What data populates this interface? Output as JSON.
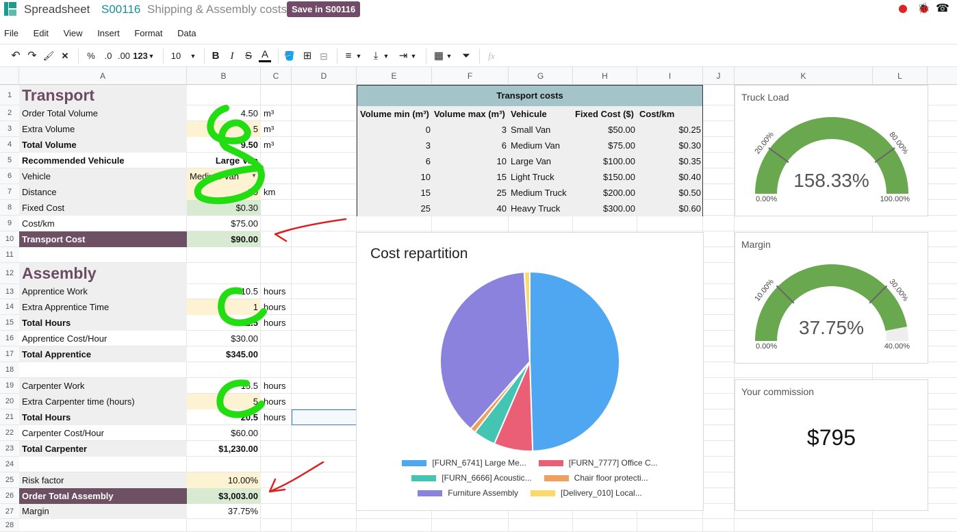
{
  "app": {
    "name": "Spreadsheet",
    "record": "S00116",
    "doc_title": "Shipping & Assembly costs",
    "save_button": "Save in S00116"
  },
  "menu": [
    "File",
    "Edit",
    "View",
    "Insert",
    "Format",
    "Data"
  ],
  "toolbar": {
    "percent": "%",
    "dec_less": ".0",
    "dec_more": ".00",
    "format": "123",
    "font_size": "10",
    "bold": "B",
    "italic": "I",
    "strike": "S",
    "text_color": "A",
    "fx": "fx"
  },
  "columns": [
    "A",
    "B",
    "C",
    "D",
    "E",
    "F",
    "G",
    "H",
    "I",
    "J",
    "K",
    "L"
  ],
  "rows": [
    "1",
    "2",
    "3",
    "4",
    "5",
    "6",
    "7",
    "8",
    "9",
    "10",
    "11",
    "12",
    "13",
    "14",
    "15",
    "16",
    "17",
    "18",
    "19",
    "20",
    "21",
    "22",
    "23",
    "24",
    "25",
    "26",
    "27",
    "28"
  ],
  "sheet": {
    "transport_title": "Transport",
    "assembly_title": "Assembly",
    "a2": "Order Total Volume",
    "b2": "4.50",
    "c2": "m³",
    "a3": "Extra Volume",
    "b3": "5",
    "c3": "m³",
    "a4": "Total Volume",
    "b4": "9.50",
    "c4": "m³",
    "a5": "Recommended Vehicule",
    "b5": "Large Van",
    "a6": "Vehicle",
    "b6": "Medium Van",
    "a7": "Distance",
    "b7": "50",
    "c7": "km",
    "a8": "Fixed Cost",
    "b8": "$0.30",
    "a9": "Cost/km",
    "b9": "$75.00",
    "a10": "Transport Cost",
    "b10": "$90.00",
    "a13": "Apprentice Work",
    "b13": "10.5",
    "c13": "hours",
    "a14": "Extra Apprentice Time",
    "b14": "1",
    "c14": "hours",
    "a15": "Total Hours",
    "b15": "11.5",
    "c15": "hours",
    "a16": "Apprentice Cost/Hour",
    "b16": "$30.00",
    "a17": "Total Apprentice",
    "b17": "$345.00",
    "a19": "Carpenter Work",
    "b19": "15.5",
    "c19": "hours",
    "a20": "Extra Carpenter time (hours)",
    "b20": "5",
    "c20": "hours",
    "a21": "Total Hours",
    "b21": "20.5",
    "c21": "hours",
    "a22": "Carpenter Cost/Hour",
    "b22": "$60.00",
    "a23": "Total Carpenter",
    "b23": "$1,230.00",
    "a25": "Risk factor",
    "b25": "10.00%",
    "a26": "Order Total Assembly",
    "b26": "$3,003.00",
    "a27": "Margin",
    "b27": "37.75%"
  },
  "transport_table": {
    "title": "Transport costs",
    "headers": [
      "Volume min (m³)",
      "Volume max (m³)",
      "Vehicule",
      "Fixed Cost ($)",
      "Cost/km"
    ],
    "rows": [
      [
        "0",
        "3",
        "Small Van",
        "$50.00",
        "$0.25"
      ],
      [
        "3",
        "6",
        "Medium Van",
        "$75.00",
        "$0.30"
      ],
      [
        "6",
        "10",
        "Large Van",
        "$100.00",
        "$0.35"
      ],
      [
        "10",
        "15",
        "Light Truck",
        "$150.00",
        "$0.40"
      ],
      [
        "15",
        "25",
        "Medium Truck",
        "$200.00",
        "$0.50"
      ],
      [
        "25",
        "40",
        "Heavy Truck",
        "$300.00",
        "$0.60"
      ]
    ]
  },
  "gauges": [
    {
      "title": "Truck Load",
      "value": "158.33%",
      "min": "0.00%",
      "max": "100.00%",
      "t1": "20.00%",
      "t2": "80.00%",
      "fill": 1.0
    },
    {
      "title": "Margin",
      "value": "37.75%",
      "min": "0.00%",
      "max": "40.00%",
      "t1": "10.00%",
      "t2": "30.00%",
      "fill": 0.94
    }
  ],
  "commission": {
    "title": "Your commission",
    "value": "$795"
  },
  "chart_data": {
    "type": "pie",
    "title": "Cost repartition",
    "series": [
      {
        "name": "[FURN_6741] Large Me...",
        "value": 49.5,
        "color": "#4ea7f0"
      },
      {
        "name": "[FURN_7777] Office C...",
        "value": 7.0,
        "color": "#ea5f76"
      },
      {
        "name": "[FURN_6666] Acoustic...",
        "value": 4.0,
        "color": "#44c5b3"
      },
      {
        "name": "Chair floor protecti...",
        "value": 1.0,
        "color": "#f0a05e"
      },
      {
        "name": "Furniture Assembly",
        "value": 37.5,
        "color": "#8a82dc"
      },
      {
        "name": "[Delivery_010] Local...",
        "value": 1.0,
        "color": "#fbd96a"
      }
    ]
  },
  "colors": {
    "header_dark": "#6e5064",
    "accent": "#6b4c62",
    "light_yellow": "#fdf2d1",
    "light_green": "#d9ead3",
    "light_gray": "#efefef",
    "table_header": "#a3c4c9",
    "gauge_green": "#6aa84f"
  }
}
